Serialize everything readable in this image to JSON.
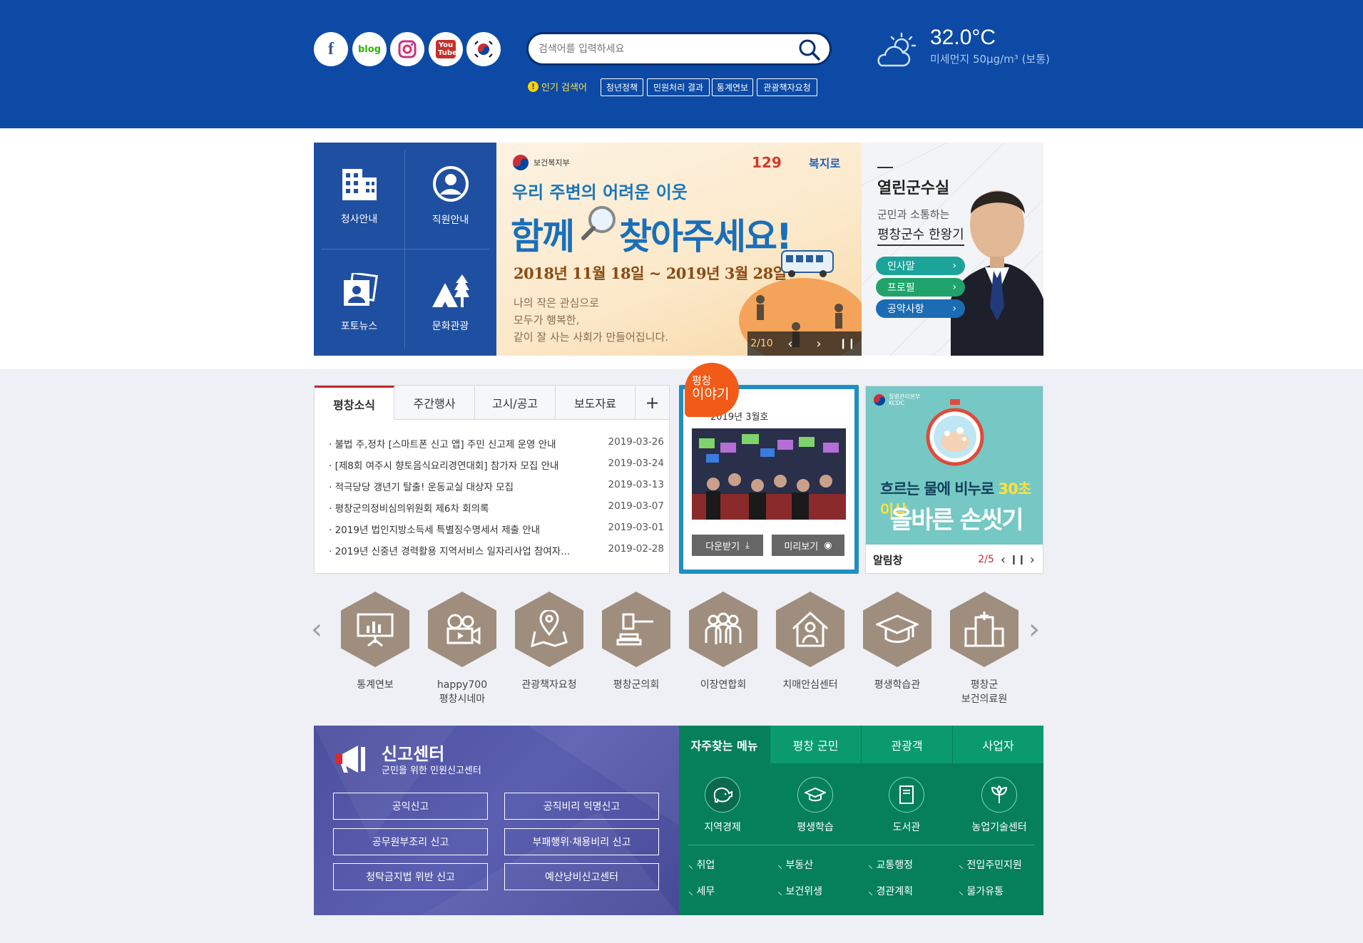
{
  "header": {
    "social": [
      {
        "name": "facebook-icon",
        "label": "f"
      },
      {
        "name": "blog-icon",
        "label": "blog"
      },
      {
        "name": "instagram-icon",
        "label": ""
      },
      {
        "name": "youtube-icon",
        "label": "You Tube"
      },
      {
        "name": "korea-flag-icon",
        "label": ""
      }
    ],
    "search": {
      "placeholder": "검색어를 입력하세요"
    },
    "popular_label": "인기 검색어",
    "keywords": [
      "청년정책",
      "민원처리 결과",
      "통계연보",
      "관광책자요청"
    ],
    "weather": {
      "temperature": "32.0°C",
      "dust": "미세먼지 50μg/m³ (보통)"
    }
  },
  "quick": {
    "items": [
      "청사안내",
      "직원안내",
      "포토뉴스",
      "문화관광"
    ]
  },
  "banner": {
    "ministry": "보건복지부",
    "hotline": "129",
    "brand": "복지로",
    "sub": "우리 주변의 어려운 이웃",
    "headline1": "함께",
    "headline2": "찾아주세요!",
    "dates": "2018년 11월 18일 ~ 2019년 3월 28일",
    "body": [
      "나의 작은 관심으로",
      "모두가 행복한,",
      "같이 잘 사는 사회가 만들어집니다."
    ],
    "counter": "2/10"
  },
  "mayor": {
    "title": "열린군수실",
    "subtitle": "군민과 소통하는",
    "name": "평창군수 한왕기",
    "buttons": [
      "인사말",
      "프로필",
      "공약사항"
    ]
  },
  "news": {
    "tabs": [
      "평창소식",
      "주간행사",
      "고시/공고",
      "보도자료"
    ],
    "more": "+",
    "items": [
      {
        "title": "불법 주,정차 [스마트폰 신고 앱] 주민 신고제 운영 안내",
        "date": "2019-03-26"
      },
      {
        "title": "[제8회 여주시 향토음식요리경연대회] 참가자 모집 안내",
        "date": "2019-03-24"
      },
      {
        "title": "적극당당 갱년기 탈출! 운동교실 대상자 모집",
        "date": "2019-03-13"
      },
      {
        "title": "평창군의정비심의위원회 제6차 회의록",
        "date": "2019-03-07"
      },
      {
        "title": "2019년 법인지방소득세 특별징수명세서 제출 안내",
        "date": "2019-03-01"
      },
      {
        "title": "2019년 신중년 경력활용 지역서비스 일자리사업 참여자...",
        "date": "2019-02-28"
      }
    ]
  },
  "story": {
    "badge1": "평창",
    "badge2": "이야기",
    "issue": "2019년 3월호",
    "download": "다운받기",
    "preview": "미리보기"
  },
  "alarm": {
    "org": "질병관리본부 KCDC",
    "line1": "흐르는 물에 비누로",
    "line1b": "30초 이상",
    "line2": "올바른 손씻기",
    "label": "알림창",
    "counter": "2/5"
  },
  "menu": {
    "items": [
      {
        "label": "통계연보",
        "icon": "presentation-icon"
      },
      {
        "label": "happy700\n평창시네마",
        "icon": "film-camera-icon"
      },
      {
        "label": "관광책자요청",
        "icon": "map-pin-icon"
      },
      {
        "label": "평창군의회",
        "icon": "gavel-icon"
      },
      {
        "label": "이장연합회",
        "icon": "group-icon"
      },
      {
        "label": "치매안심센터",
        "icon": "house-person-icon"
      },
      {
        "label": "평생학습관",
        "icon": "graduation-cap-icon"
      },
      {
        "label": "평창군\n보건의료원",
        "icon": "hospital-icon"
      }
    ]
  },
  "report": {
    "title": "신고센터",
    "subtitle": "군민을 위한 민원신고센터",
    "buttons": [
      "공익신고",
      "공직비리 익명신고",
      "공무원부조리 신고",
      "부패행위·채용비리 신고",
      "청탁금지법 위반 신고",
      "예산낭비신고센터"
    ]
  },
  "fav": {
    "tabs": [
      "자주찾는 메뉴",
      "평창 군민",
      "관광객",
      "사업자"
    ],
    "icons": [
      "지역경제",
      "평생학습",
      "도서관",
      "농업기술센터"
    ],
    "links": [
      "취업",
      "부동산",
      "교통행정",
      "전입주민지원",
      "세무",
      "보건위생",
      "경관계획",
      "물가유통"
    ]
  }
}
